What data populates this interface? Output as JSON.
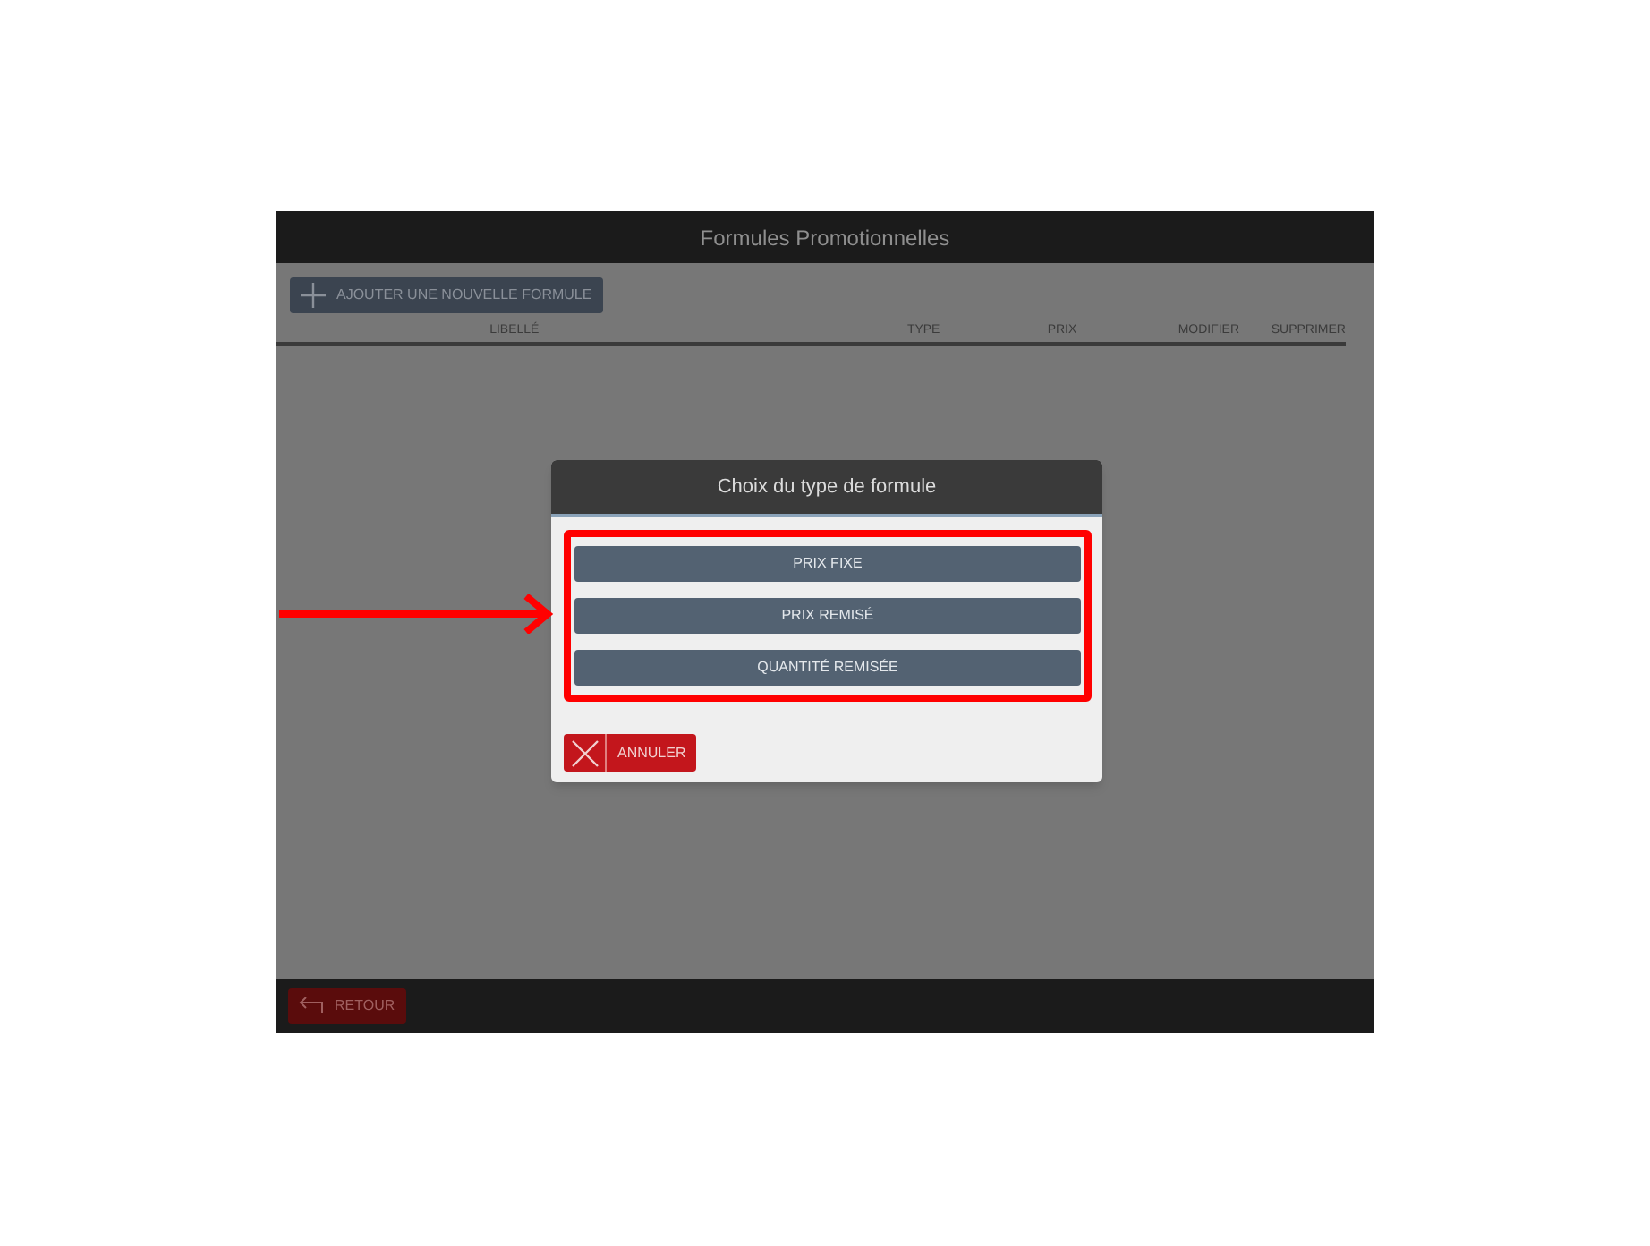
{
  "window": {
    "title": "Formules Promotionnelles"
  },
  "toolbar": {
    "add_button": "AJOUTER UNE NOUVELLE FORMULE"
  },
  "table": {
    "columns": [
      "LIBELLÉ",
      "TYPE",
      "PRIX",
      "MODIFIER",
      "SUPPRIMER"
    ]
  },
  "dialog": {
    "title": "Choix du type de formule",
    "options": [
      "PRIX FIXE",
      "PRIX REMISÉ",
      "QUANTITÉ REMISÉE"
    ],
    "cancel_button": "ANNULER"
  },
  "footer": {
    "back_button": "RETOUR"
  }
}
